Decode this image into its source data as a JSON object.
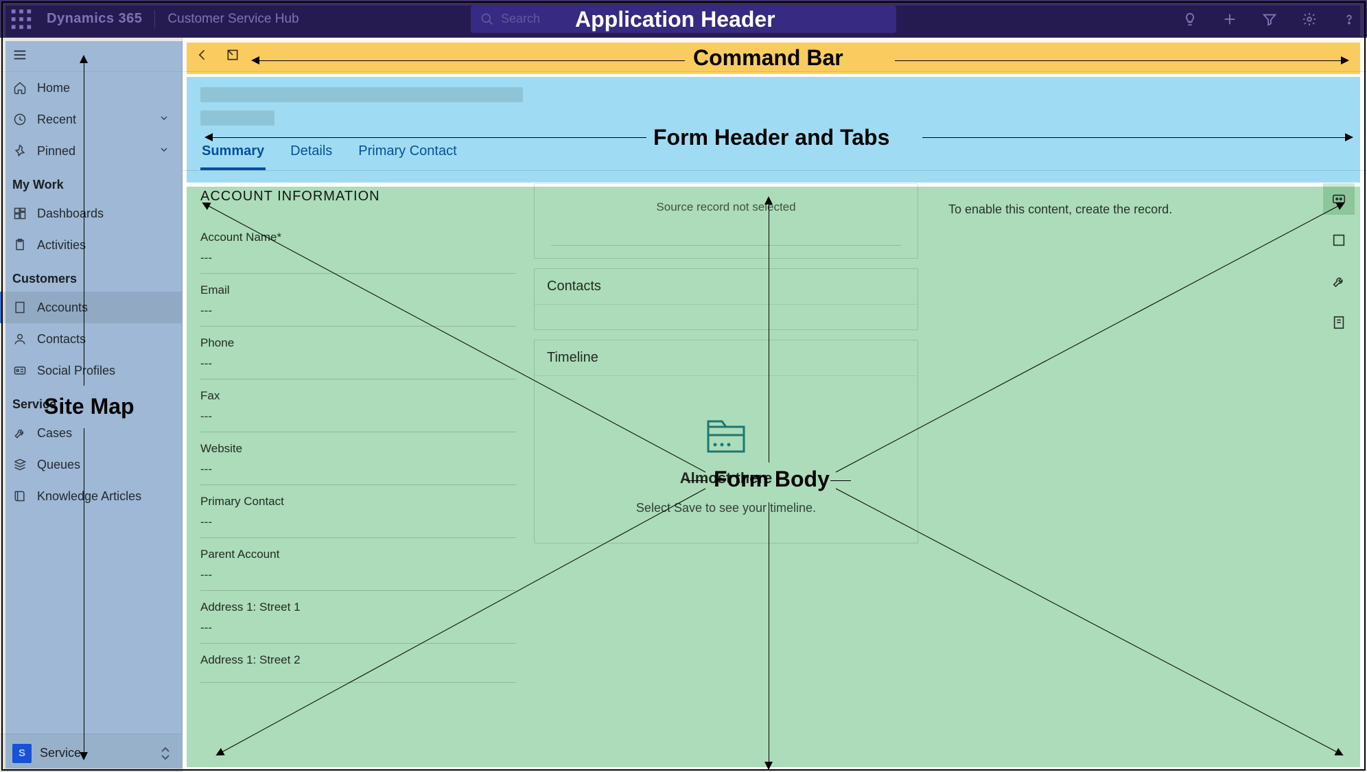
{
  "header": {
    "brand": "Dynamics 365",
    "app_name": "Customer Service Hub",
    "search_placeholder": "Search"
  },
  "annotations": {
    "app_header": "Application Header",
    "command_bar": "Command Bar",
    "form_header": "Form Header and Tabs",
    "form_body": "Form Body",
    "site_map": "Site Map"
  },
  "sidebar": {
    "items_top": [
      {
        "label": "Home",
        "icon": "home"
      },
      {
        "label": "Recent",
        "icon": "clock",
        "chevron": true
      },
      {
        "label": "Pinned",
        "icon": "pin",
        "chevron": true
      }
    ],
    "section1_title": "My Work",
    "section1_items": [
      {
        "label": "Dashboards",
        "icon": "dashboard"
      },
      {
        "label": "Activities",
        "icon": "clipboard"
      }
    ],
    "section2_title": "Customers",
    "section2_items": [
      {
        "label": "Accounts",
        "icon": "building",
        "selected": true
      },
      {
        "label": "Contacts",
        "icon": "person"
      },
      {
        "label": "Social Profiles",
        "icon": "card"
      }
    ],
    "section3_title": "Service",
    "section3_items": [
      {
        "label": "Cases",
        "icon": "wrench"
      },
      {
        "label": "Queues",
        "icon": "stack"
      },
      {
        "label": "Knowledge Articles",
        "icon": "book"
      }
    ]
  },
  "area_switcher": {
    "badge": "S",
    "label": "Service"
  },
  "tabs": [
    {
      "label": "Summary",
      "active": true
    },
    {
      "label": "Details"
    },
    {
      "label": "Primary Contact"
    }
  ],
  "form": {
    "section_title": "ACCOUNT INFORMATION",
    "fields": [
      {
        "label": "Account Name*",
        "value": "---"
      },
      {
        "label": "Email",
        "value": "---"
      },
      {
        "label": "Phone",
        "value": "---"
      },
      {
        "label": "Fax",
        "value": "---"
      },
      {
        "label": "Website",
        "value": "---"
      },
      {
        "label": "Primary Contact",
        "value": "---"
      },
      {
        "label": "Parent Account",
        "value": "---"
      },
      {
        "label": "Address 1: Street 1",
        "value": "---"
      },
      {
        "label": "Address 1: Street 2",
        "value": ""
      }
    ],
    "source_not_selected": "Source record not selected",
    "contacts_title": "Contacts",
    "timeline_title": "Timeline",
    "timeline_empty_title": "Almost there",
    "timeline_empty_sub": "Select Save to see your timeline.",
    "enable_msg": "To enable this content, create the record."
  }
}
